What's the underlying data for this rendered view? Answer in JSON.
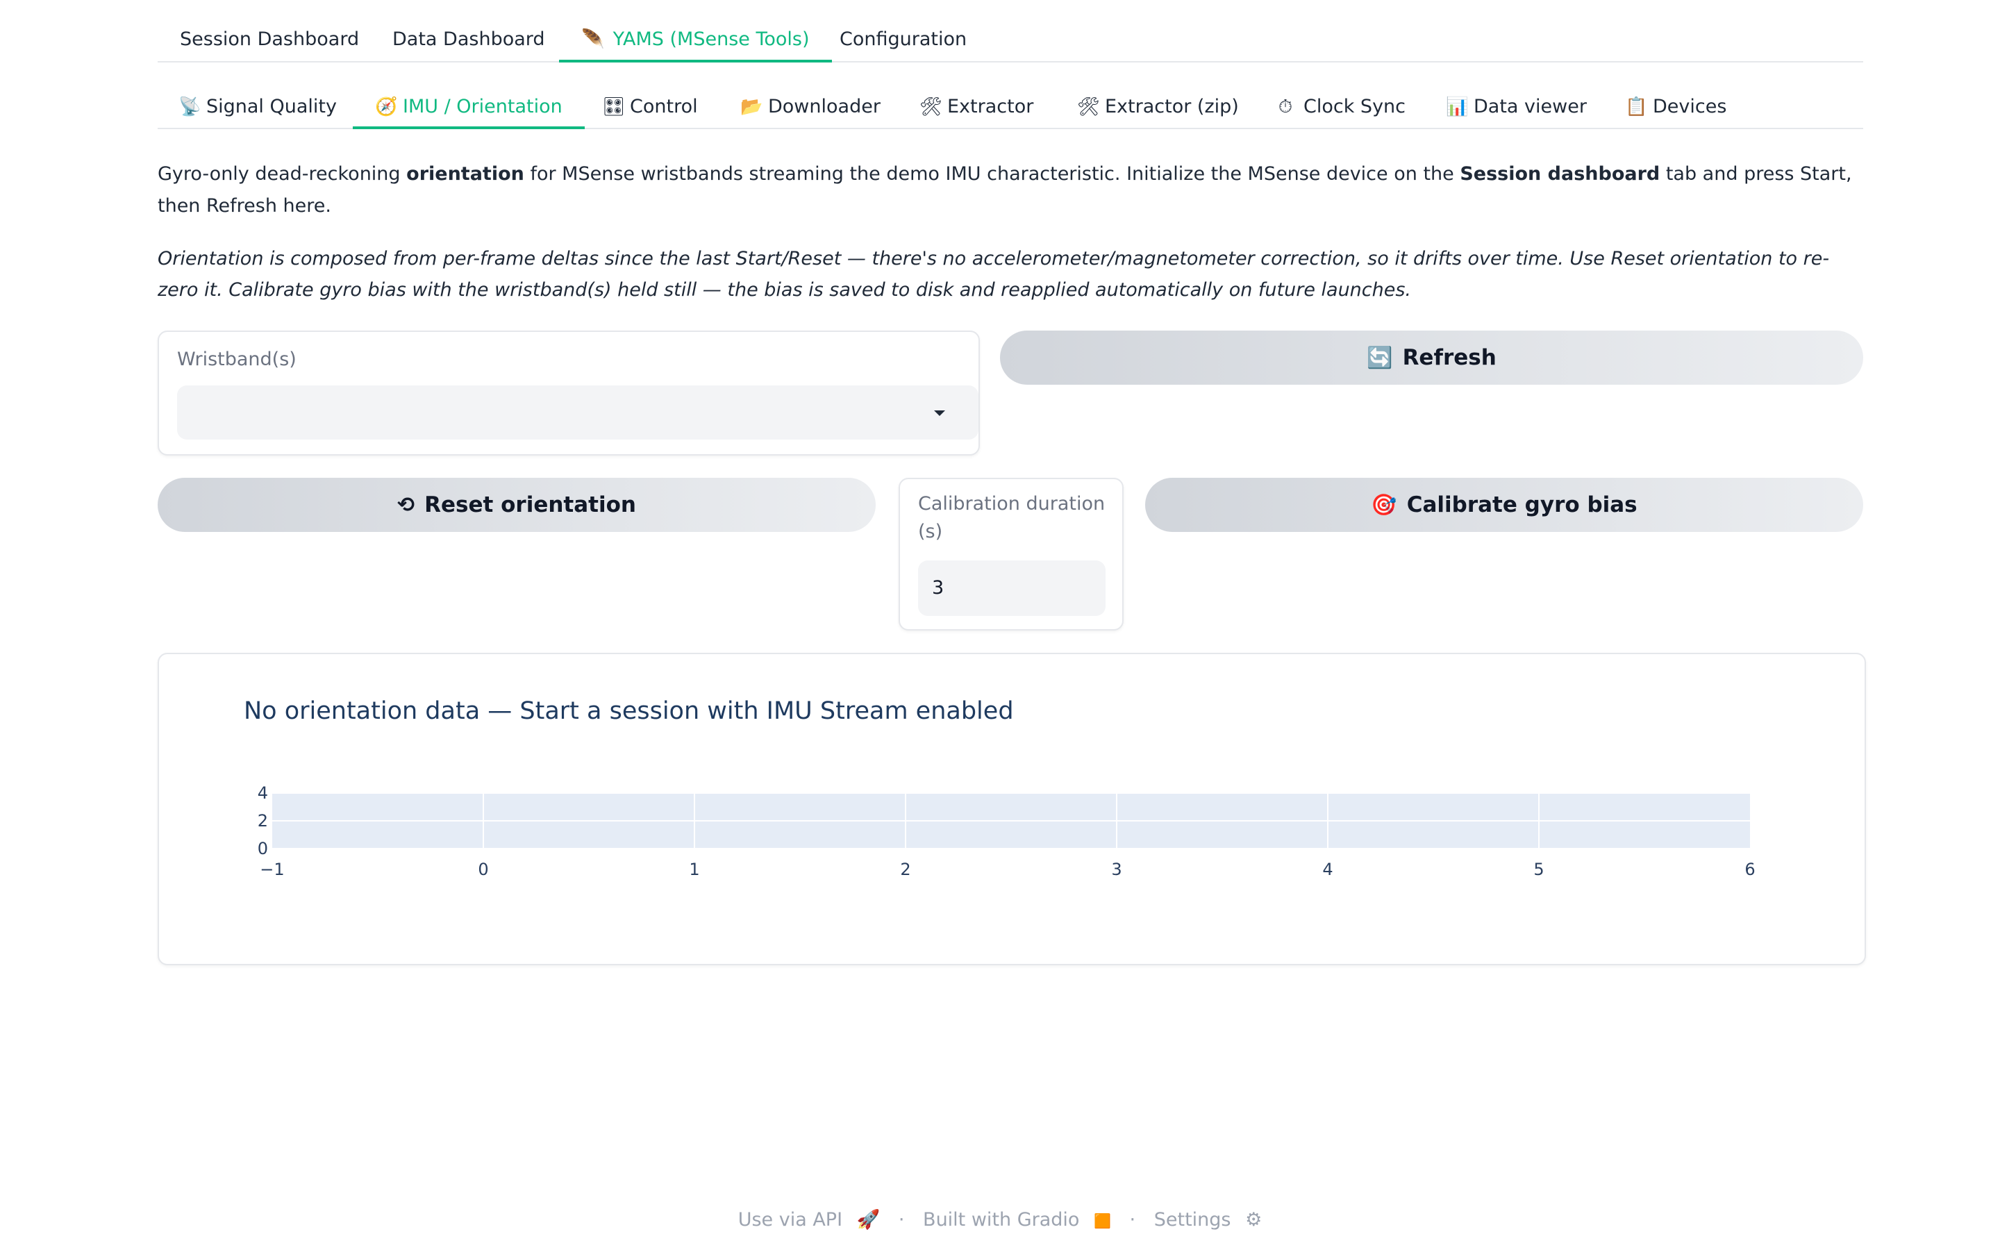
{
  "main_tabs": [
    {
      "label": "Session Dashboard"
    },
    {
      "label": "Data Dashboard"
    },
    {
      "label": "YAMS (MSense Tools)",
      "icon": "🪶"
    },
    {
      "label": "Configuration"
    }
  ],
  "sub_tabs": [
    {
      "label": "Signal Quality",
      "icon": "📡"
    },
    {
      "label": "IMU / Orientation",
      "icon": "🧭"
    },
    {
      "label": "Control",
      "icon": "🎛"
    },
    {
      "label": "Downloader",
      "icon": "📂"
    },
    {
      "label": "Extractor",
      "icon": "🛠"
    },
    {
      "label": "Extractor (zip)",
      "icon": "🛠"
    },
    {
      "label": "Clock Sync",
      "icon": "⏱"
    },
    {
      "label": "Data viewer",
      "icon": "📊"
    },
    {
      "label": "Devices",
      "icon": "📋"
    }
  ],
  "description": {
    "p1": "Gyro-only dead-reckoning ",
    "b1": "orientation",
    "p2": " for MSense wristbands streaming the demo IMU characteristic. Initialize the MSense device on the ",
    "b2": "Session dashboard",
    "p3": " tab and press Start, then Refresh here.",
    "note": "Orientation is composed from per-frame deltas since the last Start/Reset — there's no accelerometer/magnetometer correction, so it drifts over time. Use Reset orientation to re-zero it. Calibrate gyro bias with the wristband(s) held still — the bias is saved to disk and reapplied automatically on future launches."
  },
  "wristband": {
    "label": "Wristband(s)",
    "value": ""
  },
  "buttons": {
    "refresh": "Refresh",
    "refresh_icon": "🔄",
    "reset": "Reset orientation",
    "reset_icon": "⟲",
    "calibrate": "Calibrate gyro bias",
    "calibrate_icon": "🎯"
  },
  "calibration": {
    "label": "Calibration duration (s)",
    "value": "3"
  },
  "chart_data": {
    "type": "line",
    "title": "No orientation data — Start a session with IMU Stream enabled",
    "series": [],
    "x_ticks": [
      "−1",
      "0",
      "1",
      "2",
      "3",
      "4",
      "5",
      "6"
    ],
    "y_ticks": [
      "0",
      "2",
      "4"
    ],
    "xlim": [
      -1,
      6
    ],
    "ylim": [
      0,
      4
    ],
    "grid": true
  },
  "footer": {
    "api": "Use via API",
    "api_icon": "🚀",
    "sep": "·",
    "built": "Built with Gradio",
    "built_icon": "🟧",
    "settings": "Settings",
    "settings_icon": "⚙"
  }
}
